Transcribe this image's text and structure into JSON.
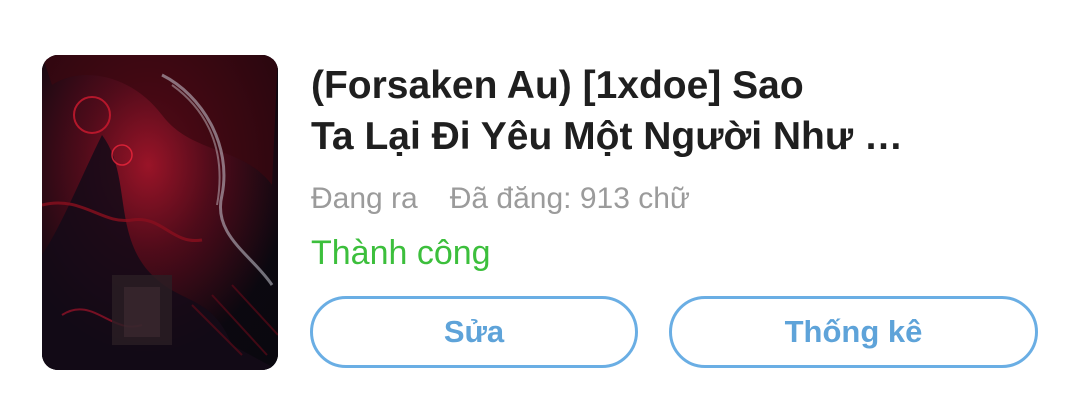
{
  "story": {
    "title_line1": "(Forsaken Au) [1xdoe] Sao",
    "title_line2": "Ta Lại Đi Yêu Một Người Như …",
    "status_label": "Đang ra",
    "word_count_label": "Đã đăng: 913 chữ",
    "result_text": "Thành công"
  },
  "actions": {
    "edit_label": "Sửa",
    "stats_label": "Thống kê"
  },
  "colors": {
    "accent": "#6aaee4",
    "success": "#3cbf3c",
    "muted": "#9b9b9b"
  }
}
